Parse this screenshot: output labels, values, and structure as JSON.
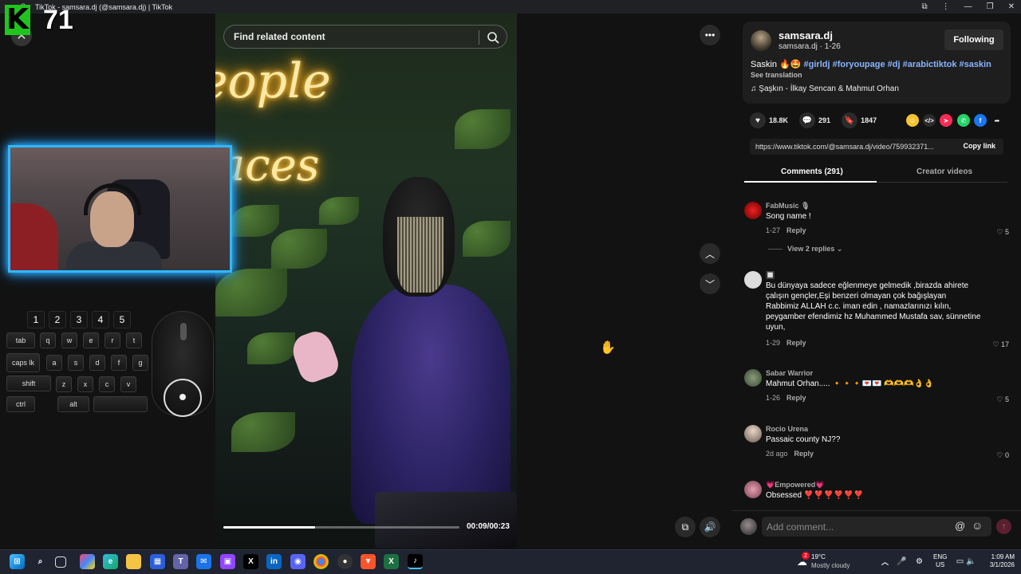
{
  "browser": {
    "tab_title": "TikTok - samsara.dj (@samsara.dj) | TikTok"
  },
  "overlay": {
    "logo_letter": "K",
    "logo_number": "71",
    "close_symbol": "✕"
  },
  "video": {
    "search_placeholder": "Find related content",
    "neon_line1": "eople",
    "neon_line2": "laces",
    "time_display": "00:09/00:23",
    "progress_fraction": 0.39
  },
  "keyboard": {
    "number_keys": [
      "1",
      "2",
      "3",
      "4",
      "5"
    ],
    "row1": [
      "tab",
      "q",
      "w",
      "e",
      "r",
      "t"
    ],
    "row2": [
      "caps lk",
      "a",
      "s",
      "d",
      "f",
      "g"
    ],
    "row3": [
      "shift",
      "z",
      "x",
      "c",
      "v"
    ],
    "row4": [
      "ctrl",
      "alt",
      ""
    ]
  },
  "post": {
    "author_name": "samsara.dj",
    "author_sub": "samsara.dj · 1-26",
    "follow_label": "Following",
    "caption_text": "Saskin 🔥🤩 ",
    "caption_tags": "#girldj #foryoupage #dj #arabictiktok #saskin",
    "see_translation": "See translation",
    "music": "♫  Şaşkın - İlkay Sencan & Mahmut Orhan",
    "likes": "18.8K",
    "comments_count": "291",
    "saves": "1847",
    "link": "https://www.tiktok.com/@samsara.dj/video/759932371...",
    "copy_link": "Copy link",
    "share_colors": [
      "#f4c430",
      "#2b2b2b",
      "#fe2c55",
      "#25d366",
      "#1877f2"
    ]
  },
  "tabs": {
    "comments": "Comments (291)",
    "creator_videos": "Creator videos"
  },
  "comments": [
    {
      "user": "FabMusic 🎙",
      "text": "Song name !",
      "date": "1-27",
      "reply": "Reply",
      "likes": "5",
      "view_replies": "View 2 replies ⌄"
    },
    {
      "user": "🔲",
      "text": "Bu dünyaya sadece eğlenmeye gelmedik ,birazda ahirete çalışın gençler,Eşi benzeri olmayan çok bağışlayan Rabbimiz ALLAH c.c. iman edin , namazlarınızı kılın, peygamber efendimiz hz Muhammed Mustafa sav, sünnetine uyun,",
      "date": "1-29",
      "reply": "Reply",
      "likes": "17"
    },
    {
      "user": "Sabar Warrior",
      "text": "Mahmut Orhan..... 🔸🔸🔸💌💌 🫶🫶🫶👌👌",
      "date": "1-26",
      "reply": "Reply",
      "likes": "5"
    },
    {
      "user": "Rocio Urena",
      "text": "Passaic county NJ??",
      "date": "2d ago",
      "reply": "Reply",
      "likes": "0"
    },
    {
      "user": "💗Empowered💗",
      "text": "Obsessed ❣️❣️❣️❣️❣️❣️",
      "date": "",
      "reply": "",
      "likes": ""
    }
  ],
  "composer": {
    "placeholder": "Add comment...",
    "at": "@",
    "emoji": "☺",
    "send": "↑"
  },
  "taskbar": {
    "weather_badge": "2",
    "temp": "19°C",
    "condition": "Mostly cloudy",
    "lang1": "ENG",
    "lang2": "US",
    "time": "1:09 AM",
    "date": "3/1/2026"
  }
}
